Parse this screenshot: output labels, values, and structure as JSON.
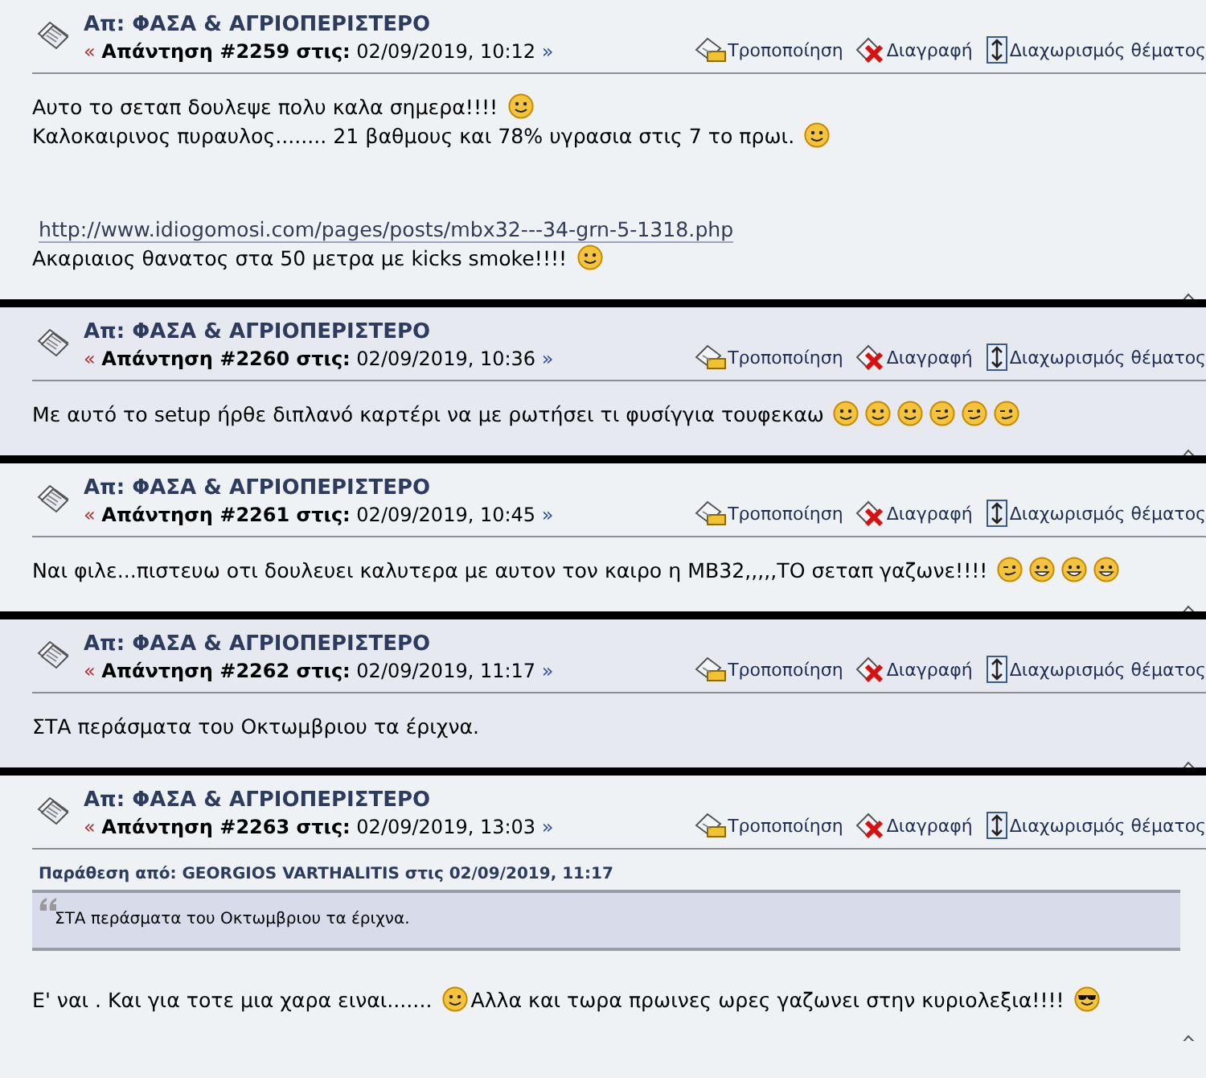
{
  "posts": [
    {
      "title": "Απ: ΦΑΣΑ & ΑΓΡΙΟΠΕΡΙΣΤΕΡΟ",
      "open_mark": "«",
      "reply_label": "Απάντηση #2259 στις:",
      "date": "02/09/2019, 10:12",
      "close_mark": "»",
      "actions": [
        {
          "kind": "edit",
          "label": "Τροποποίηση"
        },
        {
          "kind": "delete",
          "label": "Διαγραφή"
        },
        {
          "kind": "split",
          "label": "Διαχωρισμός θέματος"
        }
      ],
      "body": [
        {
          "kind": "text",
          "parts": [
            {
              "kind": "text",
              "text": "Αυτο το σεταπ δουλεψε πολυ καλα σημερα!!!!"
            },
            {
              "kind": "smile"
            }
          ]
        },
        {
          "kind": "text",
          "parts": [
            {
              "kind": "text",
              "text": "Καλοκαιρινος πυραυλος........ 21 βαθμους  και 78% υγρασια στις 7 το πρωι."
            },
            {
              "kind": "smile"
            }
          ]
        },
        {
          "kind": "link",
          "parts": [
            {
              "kind": "text",
              "text": "http://www.idiogomosi.com/pages/posts/mbx32---34-grn-5-1318.php"
            }
          ]
        },
        {
          "kind": "text",
          "parts": [
            {
              "kind": "text",
              "text": "Ακαριαιος θανατος στα 50 μετρα με kicks smoke!!!!"
            },
            {
              "kind": "smile"
            }
          ]
        }
      ]
    },
    {
      "title": "Απ: ΦΑΣΑ & ΑΓΡΙΟΠΕΡΙΣΤΕΡΟ",
      "open_mark": "«",
      "reply_label": "Απάντηση #2260 στις:",
      "date": "02/09/2019, 10:36",
      "close_mark": "»",
      "actions": [
        {
          "kind": "edit",
          "label": "Τροποποίηση"
        },
        {
          "kind": "delete",
          "label": "Διαγραφή"
        },
        {
          "kind": "split",
          "label": "Διαχωρισμός θέματος"
        }
      ],
      "body": [
        {
          "kind": "text",
          "parts": [
            {
              "kind": "text",
              "text": "Με αυτό το setup ήρθε διπλανό καρτέρι να με ρωτήσει τι φυσίγγια τουφεκαω"
            },
            {
              "kind": "smile"
            },
            {
              "kind": "smile"
            },
            {
              "kind": "smile"
            },
            {
              "kind": "wink"
            },
            {
              "kind": "wink"
            },
            {
              "kind": "wink"
            }
          ]
        }
      ]
    },
    {
      "title": "Απ: ΦΑΣΑ & ΑΓΡΙΟΠΕΡΙΣΤΕΡΟ",
      "open_mark": "«",
      "reply_label": "Απάντηση #2261 στις:",
      "date": "02/09/2019, 10:45",
      "close_mark": "»",
      "actions": [
        {
          "kind": "edit",
          "label": "Τροποποίηση"
        },
        {
          "kind": "delete",
          "label": "Διαγραφή"
        },
        {
          "kind": "split",
          "label": "Διαχωρισμός θέματος"
        }
      ],
      "body": [
        {
          "kind": "text",
          "parts": [
            {
              "kind": "text",
              "text": "Ναι φιλε...πιστευω οτι δουλευει καλυτερα  με αυτον τον καιρο η MB32,,,,,ΤΟ σεταπ γαζωνε!!!!"
            },
            {
              "kind": "wink"
            },
            {
              "kind": "grin"
            },
            {
              "kind": "grin"
            },
            {
              "kind": "grin"
            }
          ]
        }
      ]
    },
    {
      "title": "Απ: ΦΑΣΑ & ΑΓΡΙΟΠΕΡΙΣΤΕΡΟ",
      "open_mark": "«",
      "reply_label": "Απάντηση #2262 στις:",
      "date": "02/09/2019, 11:17",
      "close_mark": "»",
      "actions": [
        {
          "kind": "edit",
          "label": "Τροποποίηση"
        },
        {
          "kind": "delete",
          "label": "Διαγραφή"
        },
        {
          "kind": "split",
          "label": "Διαχωρισμός θέματος"
        }
      ],
      "body": [
        {
          "kind": "text",
          "parts": [
            {
              "kind": "text",
              "text": "ΣΤΑ περάσματα του Οκτωμβριου τα έριχνα."
            }
          ]
        }
      ]
    },
    {
      "title": "Απ: ΦΑΣΑ & ΑΓΡΙΟΠΕΡΙΣΤΕΡΟ",
      "open_mark": "«",
      "reply_label": "Απάντηση #2263 στις:",
      "date": "02/09/2019, 13:03",
      "close_mark": "»",
      "actions": [
        {
          "kind": "edit",
          "label": "Τροποποίηση"
        },
        {
          "kind": "delete",
          "label": "Διαγραφή"
        },
        {
          "kind": "split",
          "label": "Διαχωρισμός θέματος"
        }
      ],
      "quote": {
        "header": "Παράθεση από: GEORGIOS VARTHALITIS στις 02/09/2019, 11:17",
        "text": "ΣΤΑ περάσματα του Οκτωμβριου τα έριχνα."
      },
      "body": [
        {
          "kind": "text",
          "parts": [
            {
              "kind": "text",
              "text": "Ε' ναι . Και για τοτε μια χαρα ειναι......."
            },
            {
              "kind": "smile"
            },
            {
              "kind": "text",
              "text": "Αλλα και τωρα πρωινες ωρες γαζωνει στην κυριολεξια!!!!"
            },
            {
              "kind": "cool"
            }
          ]
        }
      ]
    }
  ]
}
